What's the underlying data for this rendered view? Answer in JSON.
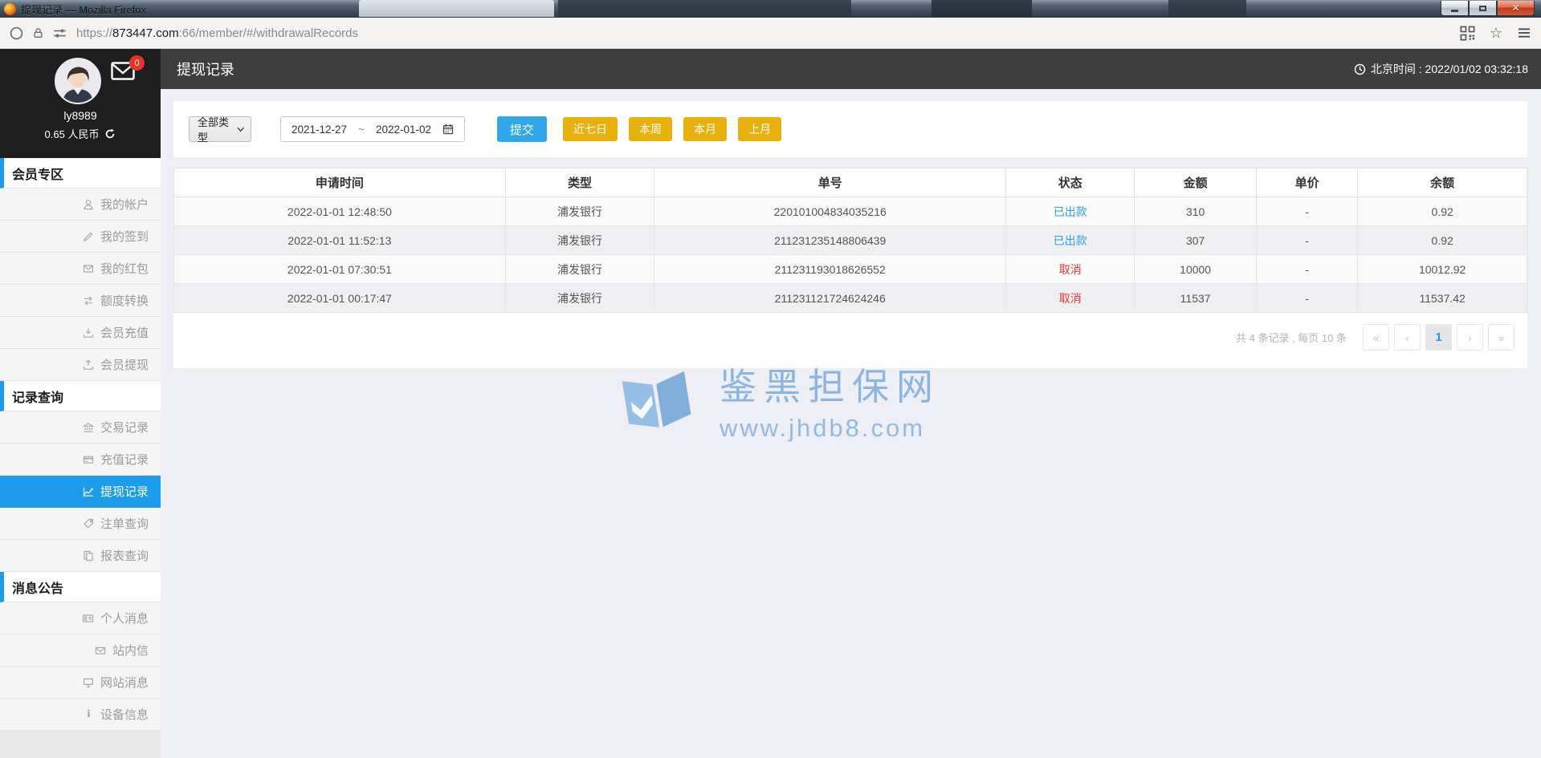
{
  "window": {
    "title": "提现记录 — Mozilla Firefox"
  },
  "urlbar": {
    "scheme": "https://",
    "host": "873447.com",
    "path": ":66/member/#/withdrawalRecords"
  },
  "user_panel": {
    "username": "ly8989",
    "balance": "0.65 人民币",
    "unread_count": "0"
  },
  "sidebar": {
    "sections": [
      {
        "title": "会员专区",
        "items": [
          {
            "label": "我的帐户"
          },
          {
            "label": "我的签到"
          },
          {
            "label": "我的红包"
          },
          {
            "label": "额度转换"
          },
          {
            "label": "会员充值"
          },
          {
            "label": "会员提现"
          }
        ]
      },
      {
        "title": "记录查询",
        "items": [
          {
            "label": "交易记录"
          },
          {
            "label": "充值记录"
          },
          {
            "label": "提现记录"
          },
          {
            "label": "注单查询"
          },
          {
            "label": "报表查询"
          }
        ]
      },
      {
        "title": "消息公告",
        "items": [
          {
            "label": "个人消息"
          },
          {
            "label": "站内信"
          },
          {
            "label": "网站消息"
          },
          {
            "label": "设备信息"
          }
        ]
      }
    ]
  },
  "header": {
    "page_title": "提现记录",
    "beijing_time": "北京时间 : 2022/01/02 03:32:18"
  },
  "filters": {
    "type_select": "全部类型",
    "date_from": "2021-12-27",
    "date_sep": "~",
    "date_to": "2022-01-02",
    "submit_label": "提交",
    "quick": {
      "last7": "近七日",
      "this_week": "本周",
      "this_month": "本月",
      "last_month": "上月"
    }
  },
  "table": {
    "columns": [
      "申请时间",
      "类型",
      "单号",
      "状态",
      "金额",
      "单价",
      "余额"
    ],
    "rows": [
      {
        "time": "2022-01-01 12:48:50",
        "type": "浦发银行",
        "order_no": "220101004834035216",
        "status": "已出款",
        "status_type": "paid",
        "amount": "310",
        "unit_price": "-",
        "balance": "0.92"
      },
      {
        "time": "2022-01-01 11:52:13",
        "type": "浦发银行",
        "order_no": "211231235148806439",
        "status": "已出款",
        "status_type": "paid",
        "amount": "307",
        "unit_price": "-",
        "balance": "0.92"
      },
      {
        "time": "2022-01-01 07:30:51",
        "type": "浦发银行",
        "order_no": "211231193018626552",
        "status": "取消",
        "status_type": "cancel",
        "amount": "10000",
        "unit_price": "-",
        "balance": "10012.92"
      },
      {
        "time": "2022-01-01 00:17:47",
        "type": "浦发银行",
        "order_no": "211231121724624246",
        "status": "取消",
        "status_type": "cancel",
        "amount": "11537",
        "unit_price": "-",
        "balance": "11537.42"
      }
    ]
  },
  "pagination": {
    "summary": "共 4 条记录 , 每页 10 条",
    "first": "«",
    "prev": "‹",
    "current": "1",
    "next": "›",
    "last": "»"
  },
  "watermark": {
    "name": "鉴黑担保网",
    "site": "www.jhdb8.com"
  },
  "colors": {
    "accent_blue": "#1d9ceb",
    "submit_blue": "#2fa7e9",
    "quick_yellow": "#e9b10e",
    "status_paid": "#2b9fe8",
    "status_cancel": "#e83333",
    "header_dark": "#3e3e3e"
  }
}
